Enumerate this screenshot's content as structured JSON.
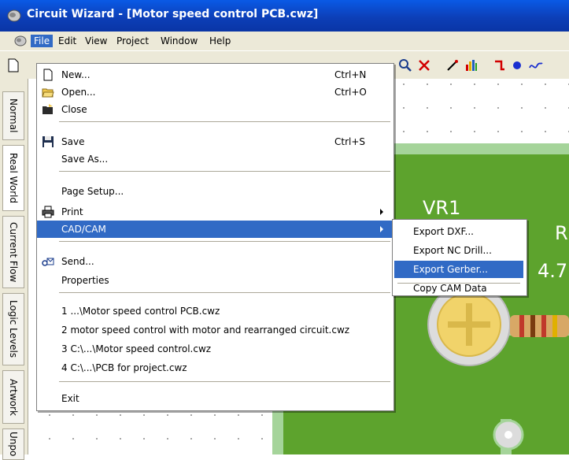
{
  "window": {
    "title": "Circuit Wizard - [Motor speed control PCB.cwz]"
  },
  "menubar": {
    "items": [
      "File",
      "Edit",
      "View",
      "Project",
      "Window",
      "Help"
    ],
    "active": "File"
  },
  "file_menu": {
    "items": [
      {
        "label": "New...",
        "shortcut": "Ctrl+N",
        "icon": "new-document-icon"
      },
      {
        "label": "Open...",
        "shortcut": "Ctrl+O",
        "icon": "open-folder-icon"
      },
      {
        "label": "Close",
        "shortcut": "",
        "icon": "close-folder-icon"
      },
      {
        "label": "Save",
        "shortcut": "Ctrl+S",
        "icon": "save-disk-icon"
      },
      {
        "label": "Save As...",
        "shortcut": "",
        "icon": ""
      },
      {
        "label": "Page Setup...",
        "shortcut": "",
        "icon": ""
      },
      {
        "label": "Print",
        "shortcut": "",
        "icon": "printer-icon",
        "submenu": true
      },
      {
        "label": "CAD/CAM",
        "shortcut": "",
        "icon": "",
        "submenu": true,
        "highlighted": true
      },
      {
        "label": "Send...",
        "shortcut": "",
        "icon": "send-mail-icon"
      },
      {
        "label": "Properties",
        "shortcut": "",
        "icon": ""
      },
      {
        "label": "1 ...\\Motor speed control PCB.cwz"
      },
      {
        "label": "2 motor speed control with motor and rearranged circuit.cwz"
      },
      {
        "label": "3 C:\\...\\Motor speed control.cwz"
      },
      {
        "label": "4 C:\\...\\PCB for project.cwz"
      },
      {
        "label": "Exit"
      }
    ]
  },
  "cadcam_submenu": {
    "items": [
      "Export DXF...",
      "Export NC Drill...",
      "Export Gerber...",
      "Copy CAM Data"
    ],
    "highlighted": "Export Gerber..."
  },
  "side_tabs": [
    "Normal",
    "Real World",
    "Current Flow",
    "Logic Levels",
    "Artwork",
    "Unpo"
  ],
  "side_tabs_active": "Real World",
  "board_labels": {
    "component": "VR1",
    "partial_ref": "R",
    "partial_value": "4.7"
  },
  "colors": {
    "titlebar": "#0c3fb8",
    "menu_highlight": "#316ac5",
    "board": "#5da32d",
    "trace": "#a5d49a"
  }
}
